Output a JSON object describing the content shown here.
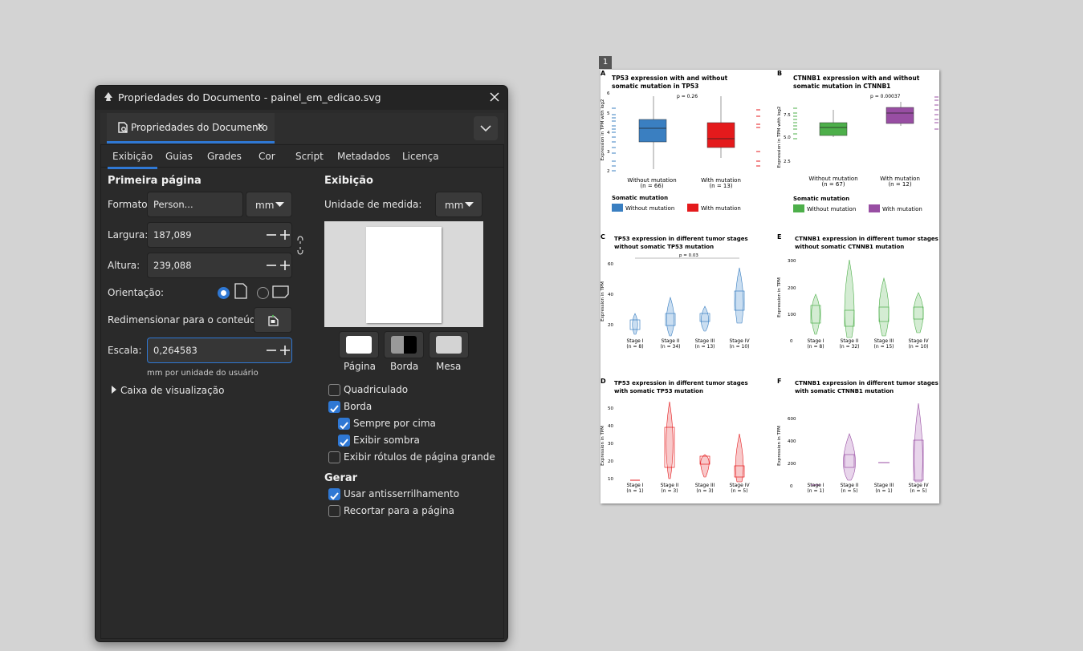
{
  "window": {
    "title": "Propriedades do Documento - painel_em_edicao.svg"
  },
  "dock": {
    "tab_label": "Propriedades do Documento",
    "tab_close": "×"
  },
  "tabs": [
    "Exibição",
    "Guias",
    "Grades",
    "Cor",
    "Script",
    "Metadados",
    "Licença"
  ],
  "left": {
    "section_title": "Primeira página",
    "format_label": "Formato:",
    "format_value": "Person...",
    "format_unit": "mm",
    "width_label": "Largura:",
    "width_value": "187,089",
    "height_label": "Altura:",
    "height_value": "239,088",
    "orientation_label": "Orientação:",
    "resize_label": "Redimensionar para o conteúdo:",
    "scale_label": "Escala:",
    "scale_value": "0,264583",
    "scale_unit_hint": "mm  por unidade do usuário",
    "viewbox_label": "Caixa de visualização"
  },
  "right": {
    "section_title": "Exibição",
    "unit_label": "Unidade de medida:",
    "unit_value": "mm",
    "swatches": [
      "Página",
      "Borda",
      "Mesa"
    ],
    "checkboxes": [
      {
        "label": "Quadriculado",
        "checked": false
      },
      {
        "label": "Borda",
        "checked": true
      },
      {
        "label": "Sempre por cima",
        "checked": true
      },
      {
        "label": "Exibir sombra",
        "checked": true
      },
      {
        "label": "Exibir rótulos de página grande",
        "checked": false
      }
    ],
    "render_title": "Gerar",
    "render_checkboxes": [
      {
        "label": "Usar antisserrilhamento",
        "checked": true
      },
      {
        "label": "Recortar para a página",
        "checked": false
      }
    ]
  },
  "canvas": {
    "page_number": "1",
    "panels": {
      "A": {
        "letter": "A",
        "title1": "TP53 expression with and without",
        "title2": "somatic mutation in TP53",
        "pval": "p = 0.26",
        "ylabel": "Expression in TPM with log2",
        "yticks": [
          "6",
          "5",
          "4",
          "3",
          "2"
        ],
        "x1": "Without mutation",
        "n1": "(n = 66)",
        "x2": "With mutation",
        "n2": "(n = 13)",
        "legend_title": "Somatic mutation",
        "leg1": "Without mutation",
        "leg2": "With mutation"
      },
      "B": {
        "letter": "B",
        "title1": "CTNNB1 expression with and without",
        "title2": "somatic mutation in CTNNB1",
        "pval": "p = 0.00037",
        "ylabel": "Expression in TPM with log2",
        "yticks": [
          "7.5",
          "5.0",
          "2.5"
        ],
        "x1": "Without mutation",
        "n1": "(n = 67)",
        "x2": "With mutation",
        "n2": "(n = 12)",
        "legend_title": "Somatic mutation",
        "leg1": "Without mutation",
        "leg2": "With mutation"
      },
      "C": {
        "letter": "C",
        "title1": "TP53 expression in different tumor stages",
        "title2": "without somatic TP53 mutation",
        "pval": "p = 0.03",
        "ylabel": "Expression in TPM",
        "yticks": [
          "60",
          "40",
          "20"
        ],
        "stages": [
          "Stage I",
          "Stage II",
          "Stage III",
          "Stage IV"
        ],
        "ns": [
          "(n = 8)",
          "(n = 34)",
          "(n = 13)",
          "(n = 10)"
        ]
      },
      "D": {
        "letter": "D",
        "title1": "TP53 expression in different tumor stages",
        "title2": "with somatic TP53 mutation",
        "ylabel": "Expression in TPM",
        "yticks": [
          "50",
          "40",
          "30",
          "20",
          "10"
        ],
        "stages": [
          "Stage I",
          "Stage II",
          "Stage III",
          "Stage IV"
        ],
        "ns": [
          "(n = 1)",
          "(n = 3)",
          "(n = 3)",
          "(n = 5)"
        ]
      },
      "E": {
        "letter": "E",
        "title1": "CTNNB1 expression in different tumor stages",
        "title2": "without somatic CTNNB1 mutation",
        "ylabel": "Expression in TPM",
        "yticks": [
          "300",
          "200",
          "100",
          "0"
        ],
        "stages": [
          "Stage I",
          "Stage II",
          "Stage III",
          "Stage IV"
        ],
        "ns": [
          "(n = 8)",
          "(n = 32)",
          "(n = 15)",
          "(n = 10)"
        ]
      },
      "F": {
        "letter": "F",
        "title1": "CTNNB1 expression in different tumor stages",
        "title2": "with somatic CTNNB1 mutation",
        "ylabel": "Expression in TPM",
        "yticks": [
          "600",
          "400",
          "200",
          "0"
        ],
        "stages": [
          "Stage I",
          "Stage II",
          "Stage III",
          "Stage IV"
        ],
        "ns": [
          "(n = 1)",
          "(n = 5)",
          "(n = 1)",
          "(n = 5)"
        ]
      }
    }
  },
  "colors": {
    "accent": "#2f78d4",
    "blue": "#3a7fc1",
    "red": "#e41a1c",
    "green": "#4daf4a",
    "purple": "#984ea3"
  }
}
